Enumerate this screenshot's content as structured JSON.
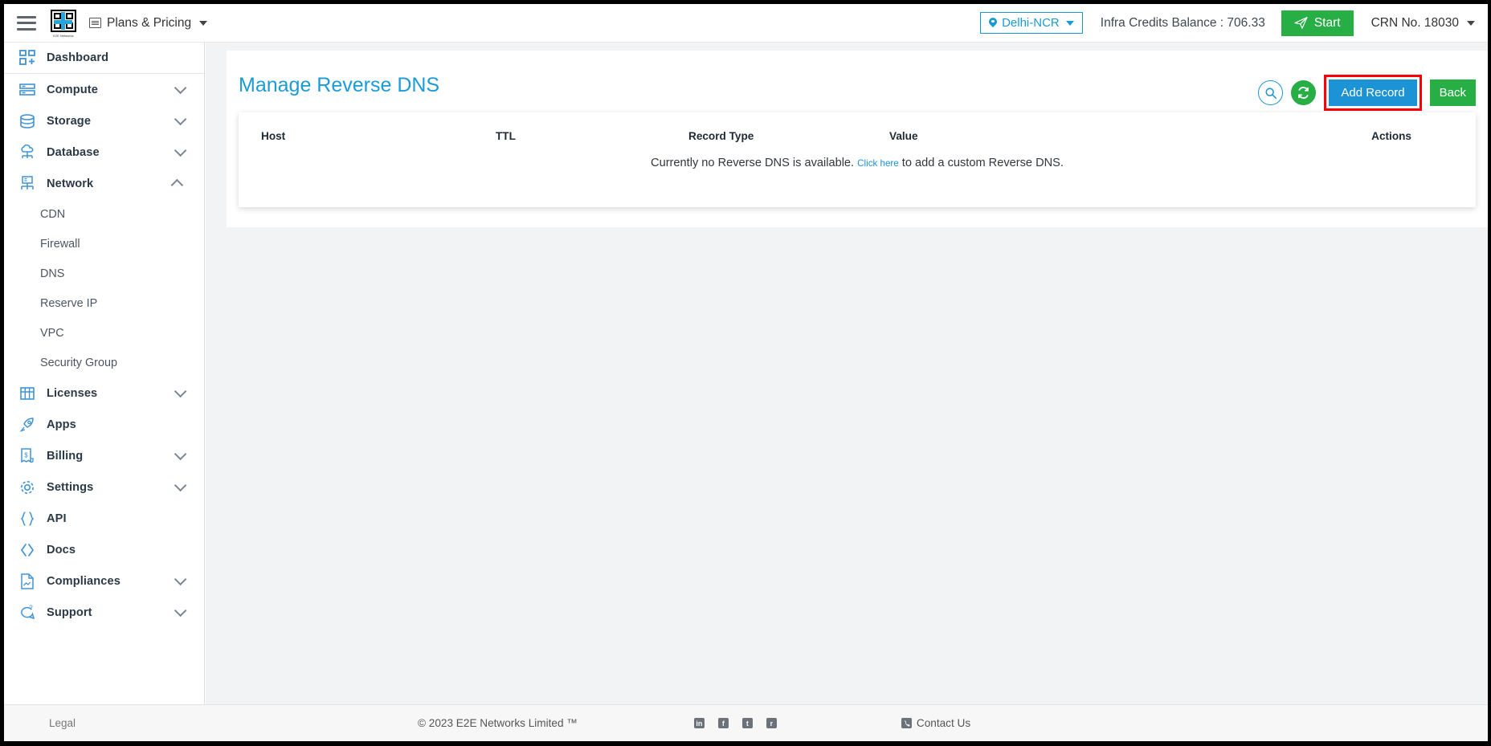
{
  "header": {
    "menu_icon": "hamburger-icon",
    "logo_text": "E2E Networks",
    "plans_label": "Plans & Pricing",
    "region": "Delhi-NCR",
    "credits": "Infra Credits Balance : 706.33",
    "start_label": "Start",
    "crn": "CRN No. 18030"
  },
  "sidebar": {
    "items": [
      {
        "label": "Dashboard",
        "icon": "dashboard-icon",
        "expandable": false
      },
      {
        "label": "Compute",
        "icon": "server-icon",
        "expandable": true,
        "state": "collapsed"
      },
      {
        "label": "Storage",
        "icon": "database-stack-icon",
        "expandable": true,
        "state": "collapsed"
      },
      {
        "label": "Database",
        "icon": "cloud-database-icon",
        "expandable": true,
        "state": "collapsed"
      },
      {
        "label": "Network",
        "icon": "network-icon",
        "expandable": true,
        "state": "expanded"
      },
      {
        "label": "Licenses",
        "icon": "license-grid-icon",
        "expandable": true,
        "state": "collapsed"
      },
      {
        "label": "Apps",
        "icon": "rocket-icon",
        "expandable": false
      },
      {
        "label": "Billing",
        "icon": "invoice-icon",
        "expandable": true,
        "state": "collapsed"
      },
      {
        "label": "Settings",
        "icon": "gear-icon",
        "expandable": true,
        "state": "collapsed"
      },
      {
        "label": "API",
        "icon": "braces-icon",
        "expandable": false
      },
      {
        "label": "Docs",
        "icon": "code-brackets-icon",
        "expandable": false
      },
      {
        "label": "Compliances",
        "icon": "document-icon",
        "expandable": true,
        "state": "collapsed"
      },
      {
        "label": "Support",
        "icon": "support-chat-icon",
        "expandable": true,
        "state": "collapsed"
      }
    ],
    "network_subitems": [
      {
        "label": "CDN"
      },
      {
        "label": "Firewall"
      },
      {
        "label": "DNS"
      },
      {
        "label": "Reserve IP"
      },
      {
        "label": "VPC"
      },
      {
        "label": "Security Group"
      }
    ]
  },
  "main": {
    "page_title": "Manage Reverse DNS",
    "actions": {
      "search_icon": "search-icon",
      "refresh_icon": "refresh-icon",
      "add_record_label": "Add Record",
      "back_label": "Back"
    },
    "table": {
      "columns": [
        "Host",
        "TTL",
        "Record Type",
        "Value",
        "Actions"
      ],
      "rows": [],
      "empty_message_before": "Currently no Reverse DNS is available.",
      "empty_link": "Click here",
      "empty_message_after": "to add a custom Reverse DNS."
    }
  },
  "footer": {
    "legal": "Legal",
    "copyright": "© 2023 E2E Networks Limited ™",
    "social": [
      "in",
      "f",
      "t",
      "r"
    ],
    "contact": "Contact Us"
  },
  "colors": {
    "accent_blue": "#1b93d4",
    "title_blue": "#1b9bd8",
    "green": "#27ae45",
    "highlight_red": "#fb0007",
    "page_bg": "#f2f3f4"
  }
}
